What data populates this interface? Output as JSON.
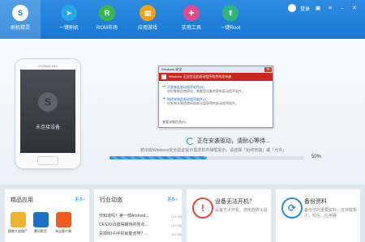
{
  "topbar": {
    "nav": [
      {
        "label": "刷机精灵",
        "icon": "shield-icon",
        "color": "#ffffff",
        "glyph": "S"
      },
      {
        "label": "一键刷机",
        "icon": "rocket-icon",
        "color": "#27a7e8",
        "glyph": "➤"
      },
      {
        "label": "ROM市场",
        "icon": "rom-market-icon",
        "color": "#3cb64a",
        "glyph": "R"
      },
      {
        "label": "应用游戏",
        "icon": "apps-games-icon",
        "color": "#f0a11c",
        "glyph": "▦"
      },
      {
        "label": "实用工具",
        "icon": "tools-icon",
        "color": "#e14a8c",
        "glyph": "✚"
      },
      {
        "label": "一键Root",
        "icon": "root-icon",
        "color": "#2fb67a",
        "glyph": "⬆"
      }
    ],
    "login_label": "登录"
  },
  "phone": {
    "brand_text": "GIONEE.NDI",
    "screen_text": "未连接设备"
  },
  "dialog": {
    "title": "Windows 安全",
    "banner": "Windows 无法验证此驱动程序软件的发布者",
    "option1_title": "不安装此驱动程序软件(N)",
    "option1_sub": "应检查制造商网站，查看您设备的更新驱动程序软件。",
    "option2_title": "始终安装此驱动程序软件(I)",
    "option2_sub": "仅安装从制造商网站或光盘获得的驱动程序软件。",
    "footer": "查看详细信息(D)"
  },
  "status": {
    "text": "正在安装驱动，请耐心等待...",
    "hint": "若出现Windows安全验证提示需求软件弹框提示，请选择「始终安装」或「允许」",
    "progress": 50,
    "progress_label": "50%"
  },
  "cards": {
    "apps": {
      "title": "精品应用",
      "more": "更多»",
      "items": [
        {
          "name": "植物大战僵尸",
          "color": "#f0b030"
        },
        {
          "name": "暴风影音",
          "color": "#1e6fc8"
        },
        {
          "name": "淘宝客户端",
          "color": "#f05a1e"
        }
      ]
    },
    "news": {
      "title": "行业动态",
      "more": "更多»",
      "items": [
        {
          "text": "你知道吗？第一部Android...",
          "date": "[12-08]"
        },
        {
          "text": "CES2015值得期待的亮点...",
          "date": "[12-08]"
        },
        {
          "text": "关掉Wi-Fi手机就能省电？...",
          "date": "[12-08]"
        }
      ]
    },
    "boot": {
      "title": "设备无法开机？",
      "desc": "设备无法开机，使用救砖工具",
      "icon_glyph": "!",
      "color": "#e8463a"
    },
    "backup": {
      "title": "备份资料",
      "desc": "备份您的重要资料，支持联系人、短信、应用等",
      "icon_glyph": "⟳",
      "color": "#2d8be0"
    }
  }
}
